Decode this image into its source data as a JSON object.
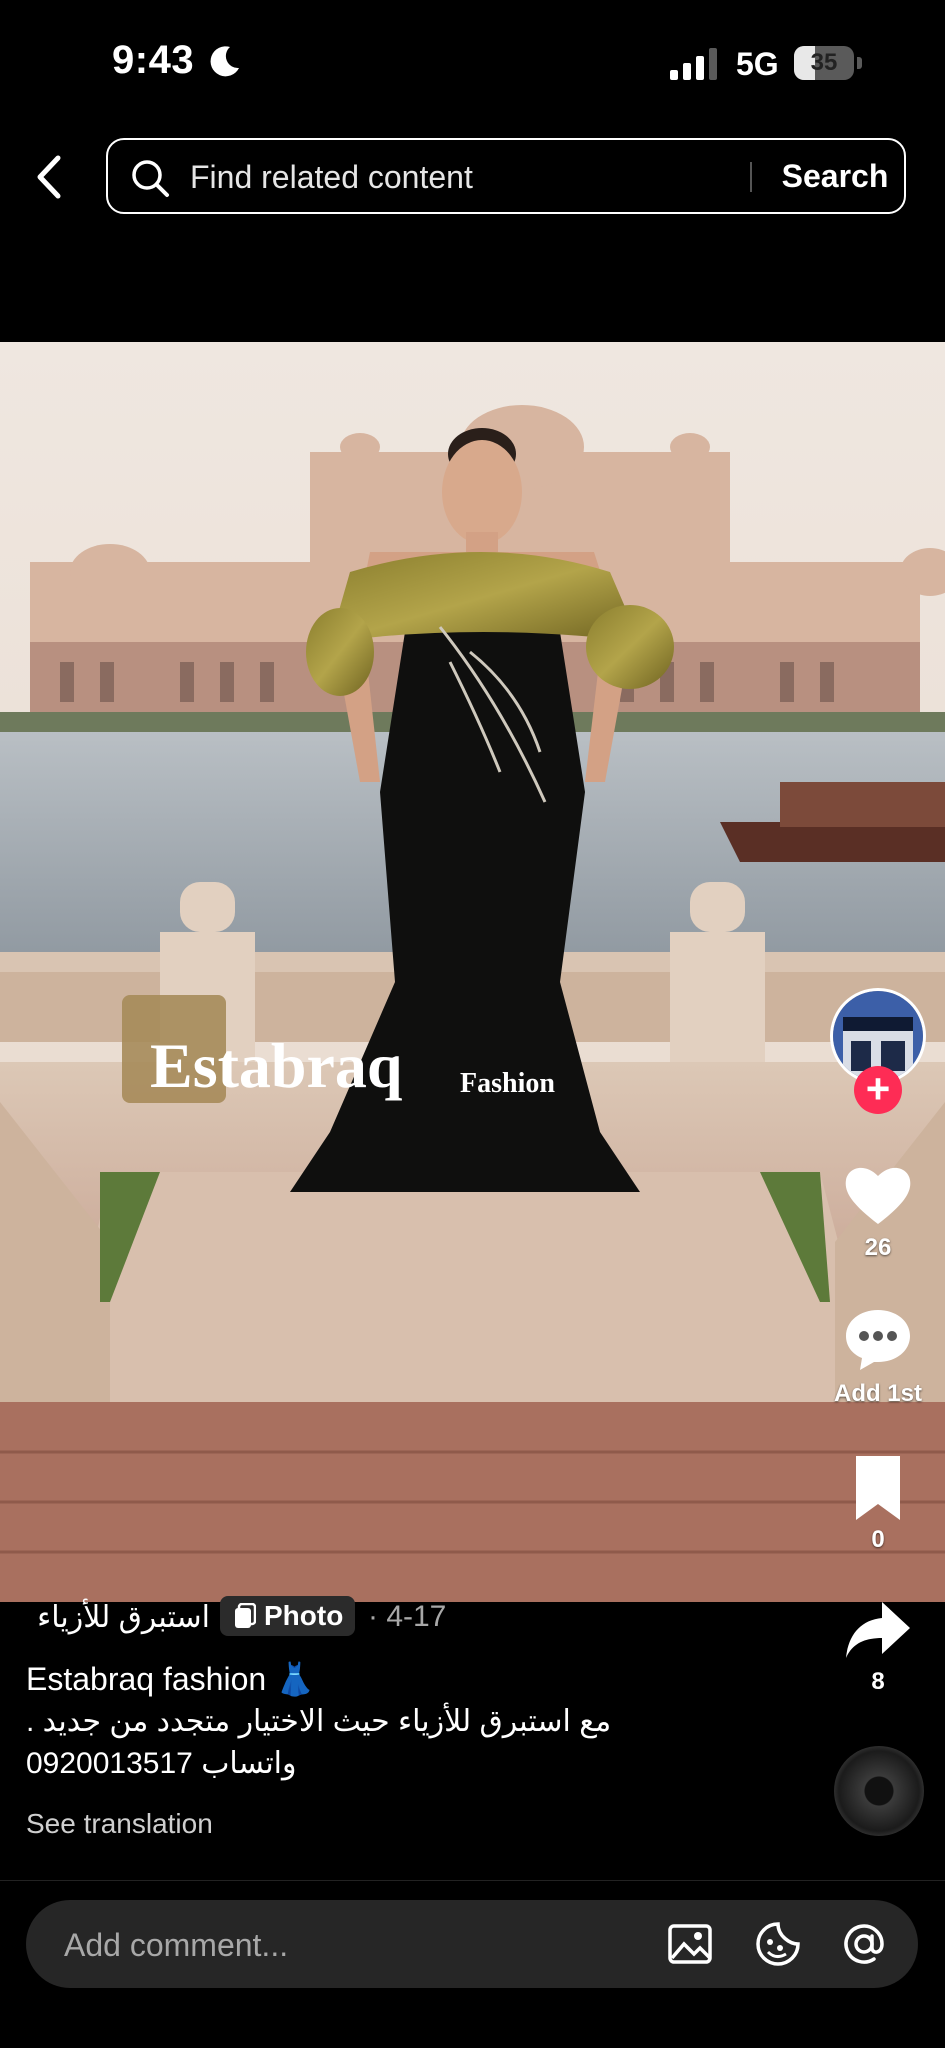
{
  "status_bar": {
    "time": "9:43",
    "network": "5G",
    "battery_level": "35",
    "battery_fraction": 0.35,
    "icons": [
      "moon-icon",
      "signal-icon",
      "battery-icon"
    ]
  },
  "search": {
    "placeholder": "Find related content",
    "button_label": "Search"
  },
  "post": {
    "image_logo_text": "Estabraq",
    "image_logo_subtext": "Fashion",
    "author": "استبرق للأزياء",
    "type_badge": "Photo",
    "date": "· 4-17",
    "caption_title": "Estabraq fashion 👗",
    "caption_line2": "مع استبرق للأزياء حيث الاختيار متجدد من جديد .",
    "caption_line3": "0920013517 واتساب",
    "see_translation": "See translation"
  },
  "actions": {
    "likes": "26",
    "comments": "Add 1st",
    "saves": "0",
    "shares": "8"
  },
  "comment_bar": {
    "placeholder": "Add comment..."
  },
  "colors": {
    "background": "#000000",
    "accent_follow": "#fe2c55",
    "comment_bar_bg": "#262626"
  }
}
